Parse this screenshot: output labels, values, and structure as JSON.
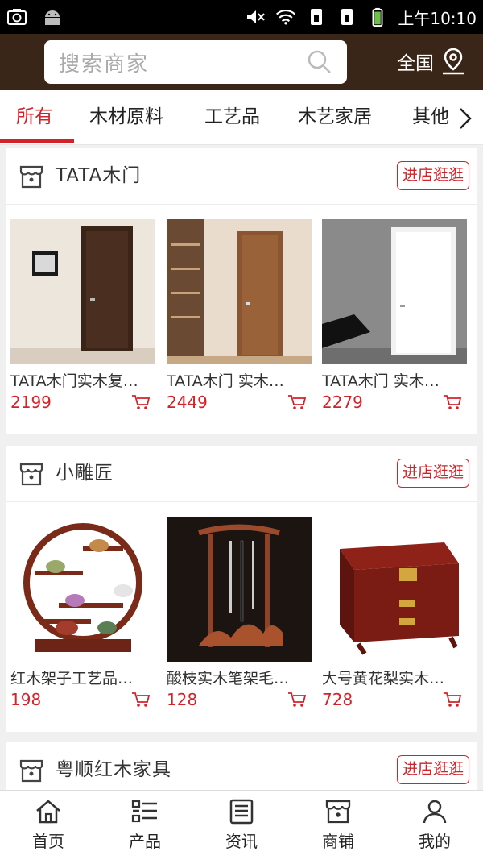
{
  "statusbar": {
    "time": "上午10:10"
  },
  "header": {
    "search_placeholder": "搜索商家",
    "region_label": "全国"
  },
  "tabs": [
    {
      "label": "所有",
      "active": true
    },
    {
      "label": "木材原料"
    },
    {
      "label": "工艺品"
    },
    {
      "label": "木艺家居"
    },
    {
      "label": "其他"
    }
  ],
  "shops": [
    {
      "name": "TATA木门",
      "visit_label": "进店逛逛",
      "products": [
        {
          "name": "TATA木门实木复…",
          "price": "2199"
        },
        {
          "name": "TATA木门 实木…",
          "price": "2449"
        },
        {
          "name": "TATA木门 实木…",
          "price": "2279"
        }
      ]
    },
    {
      "name": "小雕匠",
      "visit_label": "进店逛逛",
      "products": [
        {
          "name": "红木架子工艺品…",
          "price": "198"
        },
        {
          "name": "酸枝实木笔架毛…",
          "price": "128"
        },
        {
          "name": "大号黄花梨实木…",
          "price": "728"
        }
      ]
    },
    {
      "name": "粤顺红木家具",
      "visit_label": "进店逛逛"
    }
  ],
  "bottom_nav": [
    {
      "label": "首页",
      "icon": "home-icon"
    },
    {
      "label": "产品",
      "icon": "list-icon"
    },
    {
      "label": "资讯",
      "icon": "news-icon"
    },
    {
      "label": "商铺",
      "icon": "store-icon"
    },
    {
      "label": "我的",
      "icon": "user-icon"
    }
  ],
  "colors": {
    "accent": "#d2232a",
    "header_bg": "#3a2618"
  }
}
